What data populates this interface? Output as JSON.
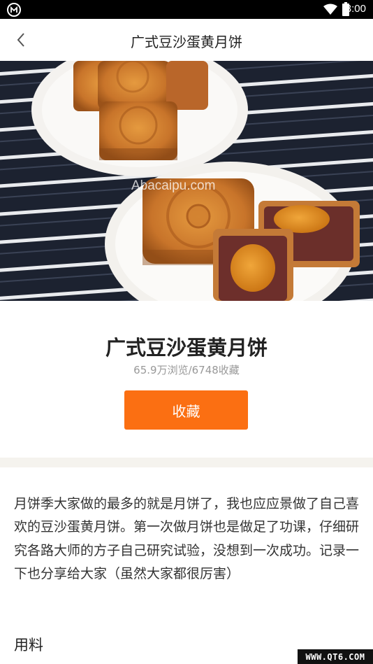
{
  "status_bar": {
    "time": "3:00",
    "app_icon": "app-badge-icon",
    "wifi_icon": "wifi-icon",
    "battery_icon": "battery-icon"
  },
  "nav": {
    "back_icon": "chevron-left-icon",
    "title": "广式豆沙蛋黄月饼"
  },
  "hero": {
    "watermark": "Abacaipu.com"
  },
  "recipe": {
    "title": "广式豆沙蛋黄月饼",
    "stats": "65.9万浏览/6748收藏",
    "collect_label": "收藏",
    "accent_color": "#fb6f12"
  },
  "description": "月饼季大家做的最多的就是月饼了，我也应应景做了自己喜欢的豆沙蛋黄月饼。第一次做月饼也是做足了功课，仔细研究各路大师的方子自己研究试验，没想到一次成功。记录一下也分享给大家（虽然大家都很厉害）",
  "ingredients": {
    "heading": "用料"
  },
  "corner_mark": "WWW.QT6.COM"
}
